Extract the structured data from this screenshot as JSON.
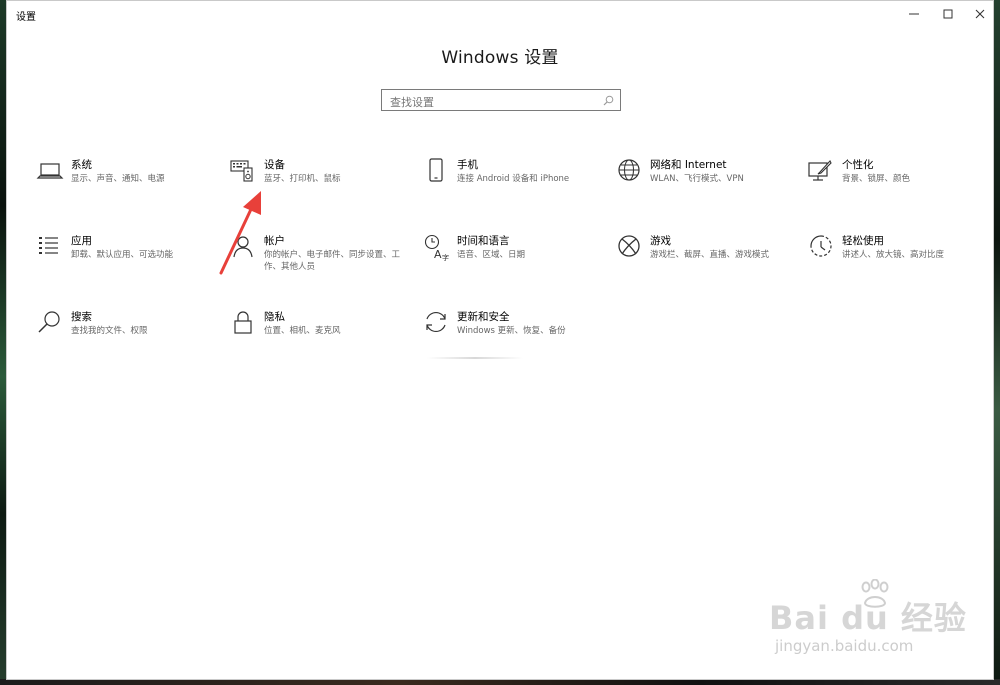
{
  "window": {
    "title": "设置",
    "controls": {
      "minimize": "minimize-icon",
      "maximize": "maximize-icon",
      "close": "close-icon"
    }
  },
  "heading": "Windows 设置",
  "search": {
    "placeholder": "查找设置",
    "icon": "search-icon"
  },
  "tiles": [
    {
      "title": "系统",
      "desc": "显示、声音、通知、电源",
      "icon": "laptop-icon"
    },
    {
      "title": "设备",
      "desc": "蓝牙、打印机、鼠标",
      "icon": "keyboard-speaker-icon"
    },
    {
      "title": "手机",
      "desc": "连接 Android 设备和 iPhone",
      "icon": "phone-icon"
    },
    {
      "title": "网络和 Internet",
      "desc": "WLAN、飞行模式、VPN",
      "icon": "globe-icon"
    },
    {
      "title": "个性化",
      "desc": "背景、锁屏、颜色",
      "icon": "paint-brush-icon"
    },
    {
      "title": "应用",
      "desc": "卸载、默认应用、可选功能",
      "icon": "apps-list-icon"
    },
    {
      "title": "帐户",
      "desc": "你的帐户、电子邮件、同步设置、工作、其他人员",
      "icon": "person-icon"
    },
    {
      "title": "时间和语言",
      "desc": "语音、区域、日期",
      "icon": "time-language-icon"
    },
    {
      "title": "游戏",
      "desc": "游戏栏、截屏、直播、游戏模式",
      "icon": "xbox-icon"
    },
    {
      "title": "轻松使用",
      "desc": "讲述人、放大镜、高对比度",
      "icon": "ease-of-access-icon"
    },
    {
      "title": "搜索",
      "desc": "查找我的文件、权限",
      "icon": "magnifier-icon"
    },
    {
      "title": "隐私",
      "desc": "位置、相机、麦克风",
      "icon": "lock-icon"
    },
    {
      "title": "更新和安全",
      "desc": "Windows 更新、恢复、备份",
      "icon": "sync-icon"
    }
  ],
  "annotation": {
    "color": "#e8403a"
  },
  "watermark": {
    "brand": "Bai du 经验",
    "url": "jingyan.baidu.com"
  },
  "colors": {
    "accent": "#0078d7",
    "text": "#000000",
    "subtext": "#666666",
    "arrow": "#e8403a"
  }
}
